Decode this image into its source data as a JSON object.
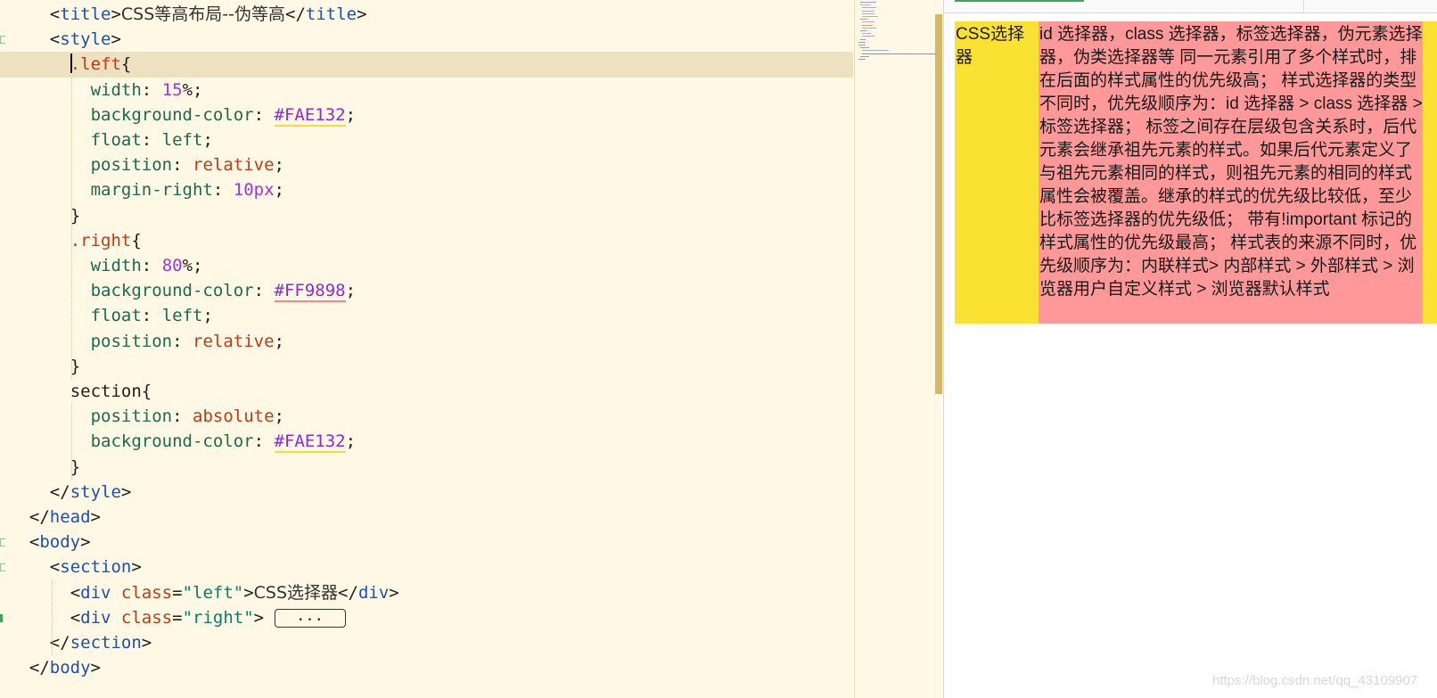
{
  "editor": {
    "lines": [
      {
        "id": "l1",
        "tokens": [
          [
            "punc",
            "<"
          ],
          [
            "tag",
            "title"
          ],
          [
            "punc",
            ">"
          ],
          [
            "text",
            "CSS等高布局--伪等高"
          ],
          [
            "punc",
            "</"
          ],
          [
            "tag",
            "title"
          ],
          [
            "punc",
            ">"
          ]
        ]
      },
      {
        "id": "l2",
        "tokens": [
          [
            "punc",
            "<"
          ],
          [
            "tag",
            "style"
          ],
          [
            "punc",
            ">"
          ]
        ]
      },
      {
        "id": "l3",
        "tokens": [
          [
            "sel",
            ".left"
          ],
          [
            "punc",
            "{"
          ]
        ]
      },
      {
        "id": "l4",
        "tokens": [
          [
            "prop",
            "width"
          ],
          [
            "punc",
            ": "
          ],
          [
            "num",
            "15"
          ],
          [
            "punc",
            "%;"
          ]
        ]
      },
      {
        "id": "l5",
        "tokens": [
          [
            "prop",
            "background-color"
          ],
          [
            "punc",
            ": "
          ],
          [
            "color_y",
            "#FAE132"
          ],
          [
            "punc",
            ";"
          ]
        ]
      },
      {
        "id": "l6",
        "tokens": [
          [
            "prop",
            "float"
          ],
          [
            "punc",
            ": "
          ],
          [
            "prop",
            "left"
          ],
          [
            "punc",
            ";"
          ]
        ]
      },
      {
        "id": "l7",
        "tokens": [
          [
            "prop",
            "position"
          ],
          [
            "punc",
            ": "
          ],
          [
            "kw",
            "relative"
          ],
          [
            "punc",
            ";"
          ]
        ]
      },
      {
        "id": "l8",
        "tokens": [
          [
            "prop",
            "margin-right"
          ],
          [
            "punc",
            ": "
          ],
          [
            "num",
            "10px"
          ],
          [
            "punc",
            ";"
          ]
        ]
      },
      {
        "id": "l9",
        "tokens": [
          [
            "punc",
            "}"
          ]
        ]
      },
      {
        "id": "l10",
        "tokens": [
          [
            "sel",
            ".right"
          ],
          [
            "punc",
            "{"
          ]
        ]
      },
      {
        "id": "l11",
        "tokens": [
          [
            "prop",
            "width"
          ],
          [
            "punc",
            ": "
          ],
          [
            "num",
            "80"
          ],
          [
            "punc",
            "%;"
          ]
        ]
      },
      {
        "id": "l12",
        "tokens": [
          [
            "prop",
            "background-color"
          ],
          [
            "punc",
            ": "
          ],
          [
            "color_p",
            "#FF9898"
          ],
          [
            "punc",
            ";"
          ]
        ]
      },
      {
        "id": "l13",
        "tokens": [
          [
            "prop",
            "float"
          ],
          [
            "punc",
            ": "
          ],
          [
            "prop",
            "left"
          ],
          [
            "punc",
            ";"
          ]
        ]
      },
      {
        "id": "l14",
        "tokens": [
          [
            "prop",
            "position"
          ],
          [
            "punc",
            ": "
          ],
          [
            "kw",
            "relative"
          ],
          [
            "punc",
            ";"
          ]
        ]
      },
      {
        "id": "l15",
        "tokens": [
          [
            "punc",
            "}"
          ]
        ]
      },
      {
        "id": "l16",
        "tokens": [
          [
            "punc",
            "section{"
          ]
        ]
      },
      {
        "id": "l17",
        "tokens": [
          [
            "prop",
            "position"
          ],
          [
            "punc",
            ": "
          ],
          [
            "kw",
            "absolute"
          ],
          [
            "punc",
            ";"
          ]
        ]
      },
      {
        "id": "l18",
        "tokens": [
          [
            "prop",
            "background-color"
          ],
          [
            "punc",
            ": "
          ],
          [
            "color_y",
            "#FAE132"
          ],
          [
            "punc",
            ";"
          ]
        ]
      },
      {
        "id": "l19",
        "tokens": [
          [
            "punc",
            "}"
          ]
        ]
      },
      {
        "id": "l20",
        "tokens": [
          [
            "punc",
            "</"
          ],
          [
            "tag",
            "style"
          ],
          [
            "punc",
            ">"
          ]
        ]
      },
      {
        "id": "l21",
        "tokens": [
          [
            "punc",
            "</"
          ],
          [
            "tag",
            "head"
          ],
          [
            "punc",
            ">"
          ]
        ]
      },
      {
        "id": "l22",
        "tokens": [
          [
            "punc",
            "<"
          ],
          [
            "tag",
            "body"
          ],
          [
            "punc",
            ">"
          ]
        ]
      },
      {
        "id": "l23",
        "tokens": [
          [
            "punc",
            "<"
          ],
          [
            "tag",
            "section"
          ],
          [
            "punc",
            ">"
          ]
        ]
      },
      {
        "id": "l24",
        "tokens": [
          [
            "punc",
            "<"
          ],
          [
            "tag",
            "div "
          ],
          [
            "attr",
            "class"
          ],
          [
            "punc",
            "="
          ],
          [
            "str",
            "\"left\""
          ],
          [
            "punc",
            ">"
          ],
          [
            "text",
            "CSS选择器"
          ],
          [
            "punc",
            "</"
          ],
          [
            "tag",
            "div"
          ],
          [
            "punc",
            ">"
          ]
        ]
      },
      {
        "id": "l25",
        "tokens": [
          [
            "punc",
            "<"
          ],
          [
            "tag",
            "div "
          ],
          [
            "attr",
            "class"
          ],
          [
            "punc",
            "="
          ],
          [
            "str",
            "\"right\""
          ],
          [
            "punc",
            "> "
          ],
          [
            "fold",
            "..."
          ]
        ]
      },
      {
        "id": "l26",
        "tokens": [
          [
            "punc",
            "</"
          ],
          [
            "tag",
            "section"
          ],
          [
            "punc",
            ">"
          ]
        ]
      },
      {
        "id": "l27",
        "tokens": [
          [
            "punc",
            "</"
          ],
          [
            "tag",
            "body"
          ],
          [
            "punc",
            ">"
          ]
        ]
      }
    ]
  },
  "preview": {
    "left_text": "CSS选择器",
    "right_text": "id 选择器，class 选择器，标签选择器，伪元素选择器，伪类选择器等 同一元素引用了多个样式时，排在后面的样式属性的优先级高； 样式选择器的类型不同时，优先级顺序为：id 选择器 > class 选择器 > 标签选择器； 标签之间存在层级包含关系时，后代元素会继承祖先元素的样式。如果后代元素定义了与祖先元素相同的样式，则祖先元素的相同的样式属性会被覆盖。继承的样式的优先级比较低，至少比标签选择器的优先级低； 带有!important 标记的样式属性的优先级最高； 样式表的来源不同时，优先级顺序为：内联样式> 内部样式 > 外部样式 > 浏览器用户自定义样式 > 浏览器默认样式",
    "left_bg": "#FAE132",
    "right_bg": "#FF9898"
  },
  "watermark": "https://blog.csdn.net/qq_43109907"
}
